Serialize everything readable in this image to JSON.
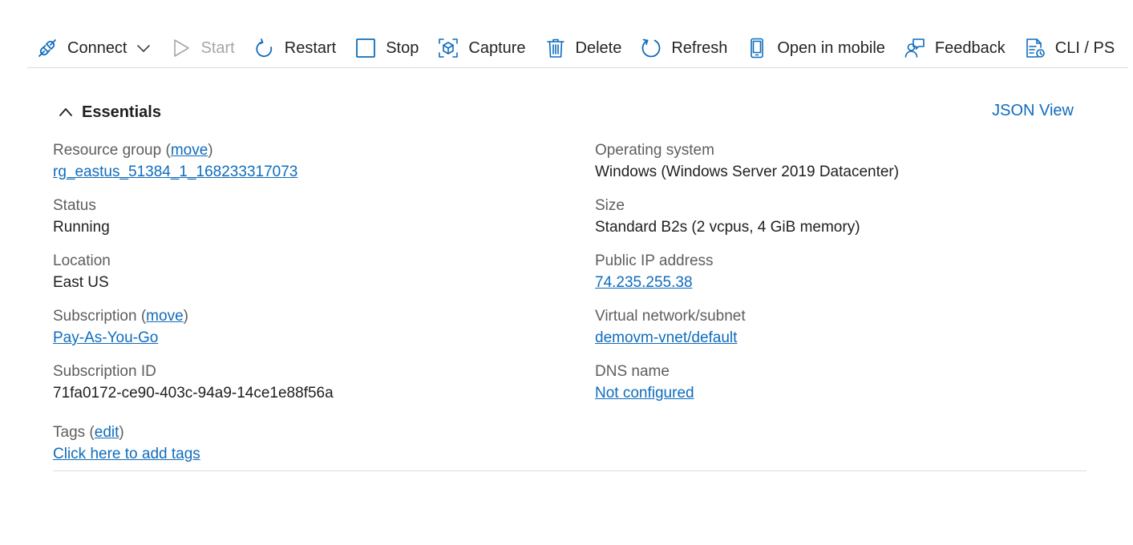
{
  "toolbar": {
    "connect": "Connect",
    "start": "Start",
    "restart": "Restart",
    "stop": "Stop",
    "capture": "Capture",
    "delete": "Delete",
    "refresh": "Refresh",
    "open_mobile": "Open in mobile",
    "feedback": "Feedback",
    "cli": "CLI / PS"
  },
  "essentials": {
    "title": "Essentials",
    "json_view": "JSON View"
  },
  "left": {
    "resource_group_label": "Resource group",
    "resource_group_move": "move",
    "resource_group_value": "rg_eastus_51384_1_168233317073",
    "status_label": "Status",
    "status_value": "Running",
    "location_label": "Location",
    "location_value": "East US",
    "subscription_label": "Subscription",
    "subscription_move": "move",
    "subscription_value": "Pay-As-You-Go",
    "subscription_id_label": "Subscription ID",
    "subscription_id_value": "71fa0172-ce90-403c-94a9-14ce1e88f56a"
  },
  "right": {
    "os_label": "Operating system",
    "os_value": "Windows (Windows Server 2019 Datacenter)",
    "size_label": "Size",
    "size_value": "Standard B2s (2 vcpus, 4 GiB memory)",
    "ip_label": "Public IP address",
    "ip_value": "74.235.255.38",
    "vnet_label": "Virtual network/subnet",
    "vnet_value": "demovm-vnet/default",
    "dns_label": "DNS name",
    "dns_value": "Not configured"
  },
  "tags": {
    "label": "Tags",
    "edit": "edit",
    "add": "Click here to add tags"
  },
  "colors": {
    "accent": "#0f6cbd",
    "disabled": "#a6a6a6",
    "label": "#605e5c"
  }
}
